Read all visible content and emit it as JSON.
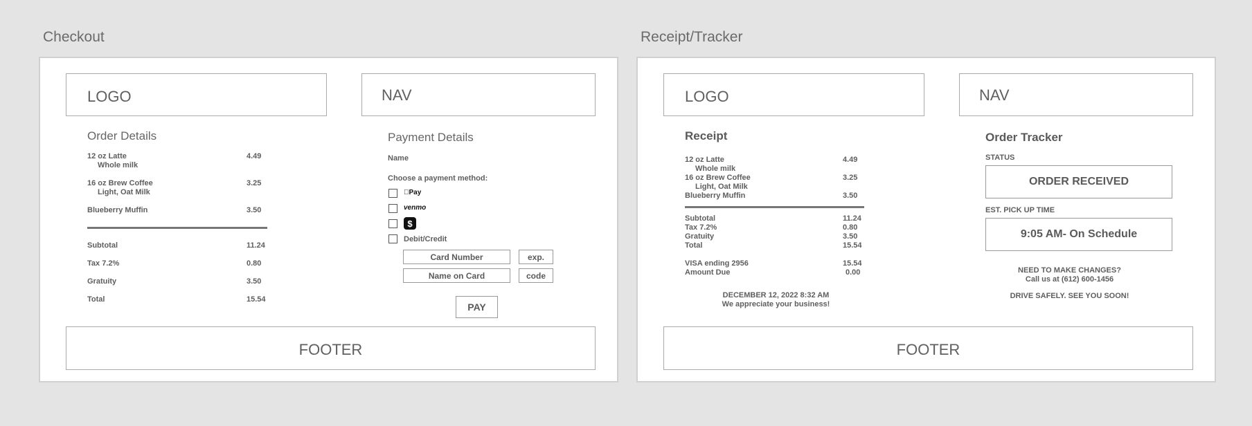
{
  "checkout": {
    "title": "Checkout",
    "logo": "LOGO",
    "nav": "NAV",
    "footer": "FOOTER",
    "order": {
      "heading": "Order Details",
      "items": [
        {
          "name": "12 oz Latte",
          "detail": "Whole milk",
          "price": "4.49"
        },
        {
          "name": "16 oz Brew Coffee",
          "detail": "Light, Oat Milk",
          "price": "3.25"
        },
        {
          "name": "Blueberry Muffin",
          "detail": "",
          "price": "3.50"
        }
      ],
      "totals": [
        {
          "label": "Subtotal",
          "value": "11.24"
        },
        {
          "label": "Tax 7.2%",
          "value": "0.80"
        },
        {
          "label": "Gratuity",
          "value": "3.50"
        },
        {
          "label": "Total",
          "value": "15.54"
        }
      ]
    },
    "payment": {
      "heading": "Payment Details",
      "name_label": "Name",
      "choose_label": "Choose a payment method:",
      "applepay": "Pay",
      "venmo": "venmo",
      "cashapp": "$",
      "debit": "Debit/Credit",
      "card_number": "Card Number",
      "exp": "exp.",
      "name_on_card": "Name on Card",
      "code": "code",
      "pay": "PAY"
    }
  },
  "receipt": {
    "title": "Receipt/Tracker",
    "logo": "LOGO",
    "nav": "NAV",
    "footer": "FOOTER",
    "heading": "Receipt",
    "items": [
      {
        "name": "12 oz Latte",
        "detail": "Whole milk",
        "price": "4.49"
      },
      {
        "name": "16 oz Brew Coffee",
        "detail": "Light, Oat Milk",
        "price": "3.25"
      },
      {
        "name": "Blueberry Muffin",
        "detail": "",
        "price": "3.50"
      }
    ],
    "totals": [
      {
        "label": "Subtotal",
        "value": "11.24"
      },
      {
        "label": "Tax 7.2%",
        "value": "0.80"
      },
      {
        "label": "Gratuity",
        "value": "3.50"
      },
      {
        "label": "Total",
        "value": "15.54"
      }
    ],
    "payments": [
      {
        "label": "VISA ending 2956",
        "value": "15.54"
      },
      {
        "label": "Amount Due",
        "value": "0.00"
      }
    ],
    "date": "DECEMBER 12, 2022 8:32 AM",
    "thanks": "We appreciate your business!",
    "tracker": {
      "heading": "Order Tracker",
      "status_label": "STATUS",
      "status": "ORDER RECEIVED",
      "pickup_label": "EST. PICK UP TIME",
      "pickup": "9:05 AM- On Schedule",
      "changes": "NEED TO MAKE CHANGES?",
      "call": "Call us at (612) 600-1456",
      "drive": "DRIVE SAFELY. SEE YOU SOON!"
    }
  }
}
